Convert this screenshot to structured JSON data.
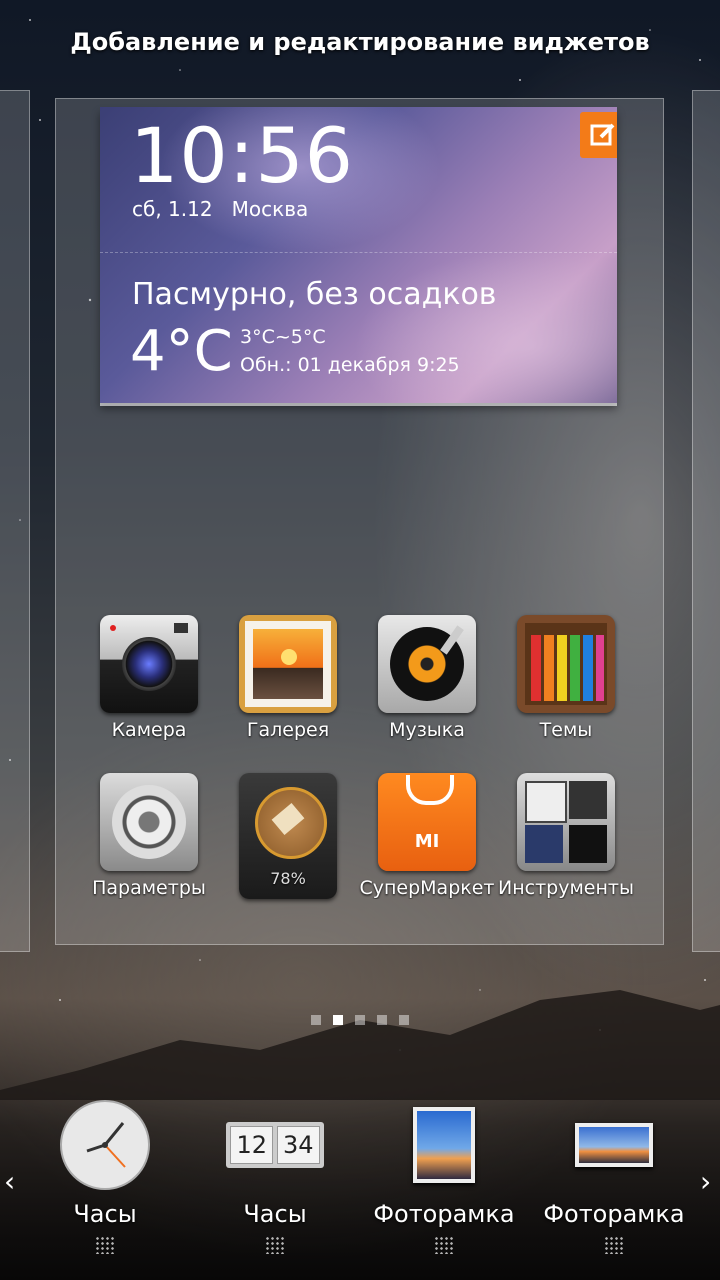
{
  "header": {
    "title": "Добавление и редактирование виджетов"
  },
  "weather_widget": {
    "time": "10:56",
    "date": "сб, 1.12",
    "city": "Москва",
    "condition": "Пасмурно, без осадков",
    "temperature": "4°C",
    "range": "3°C~5°C",
    "updated": "Обн.:  01 декабря 9:25",
    "edit_icon": "edit-icon",
    "accent": "#f37b18"
  },
  "apps": [
    {
      "label": "Камера",
      "icon": "camera-icon"
    },
    {
      "label": "Галерея",
      "icon": "gallery-icon"
    },
    {
      "label": "Музыка",
      "icon": "music-icon"
    },
    {
      "label": "Темы",
      "icon": "themes-icon"
    },
    {
      "label": "Параметры",
      "icon": "settings-icon"
    },
    {
      "label": "78%",
      "icon": "cleaner-icon"
    },
    {
      "label": "СуперМаркет",
      "icon": "market-icon",
      "badge": "MI"
    },
    {
      "label": "Инструменты",
      "icon": "tools-icon"
    }
  ],
  "pager": {
    "count": 5,
    "active": 1
  },
  "widget_tray": {
    "items": [
      {
        "label": "Часы",
        "icon": "analog-clock-icon"
      },
      {
        "label": "Часы",
        "icon": "flip-clock-icon",
        "hours": "12",
        "minutes": "34"
      },
      {
        "label": "Фоторамка",
        "icon": "photo-frame-portrait-icon"
      },
      {
        "label": "Фоторамка",
        "icon": "photo-frame-landscape-icon"
      }
    ],
    "prev": "‹",
    "next": "›"
  }
}
